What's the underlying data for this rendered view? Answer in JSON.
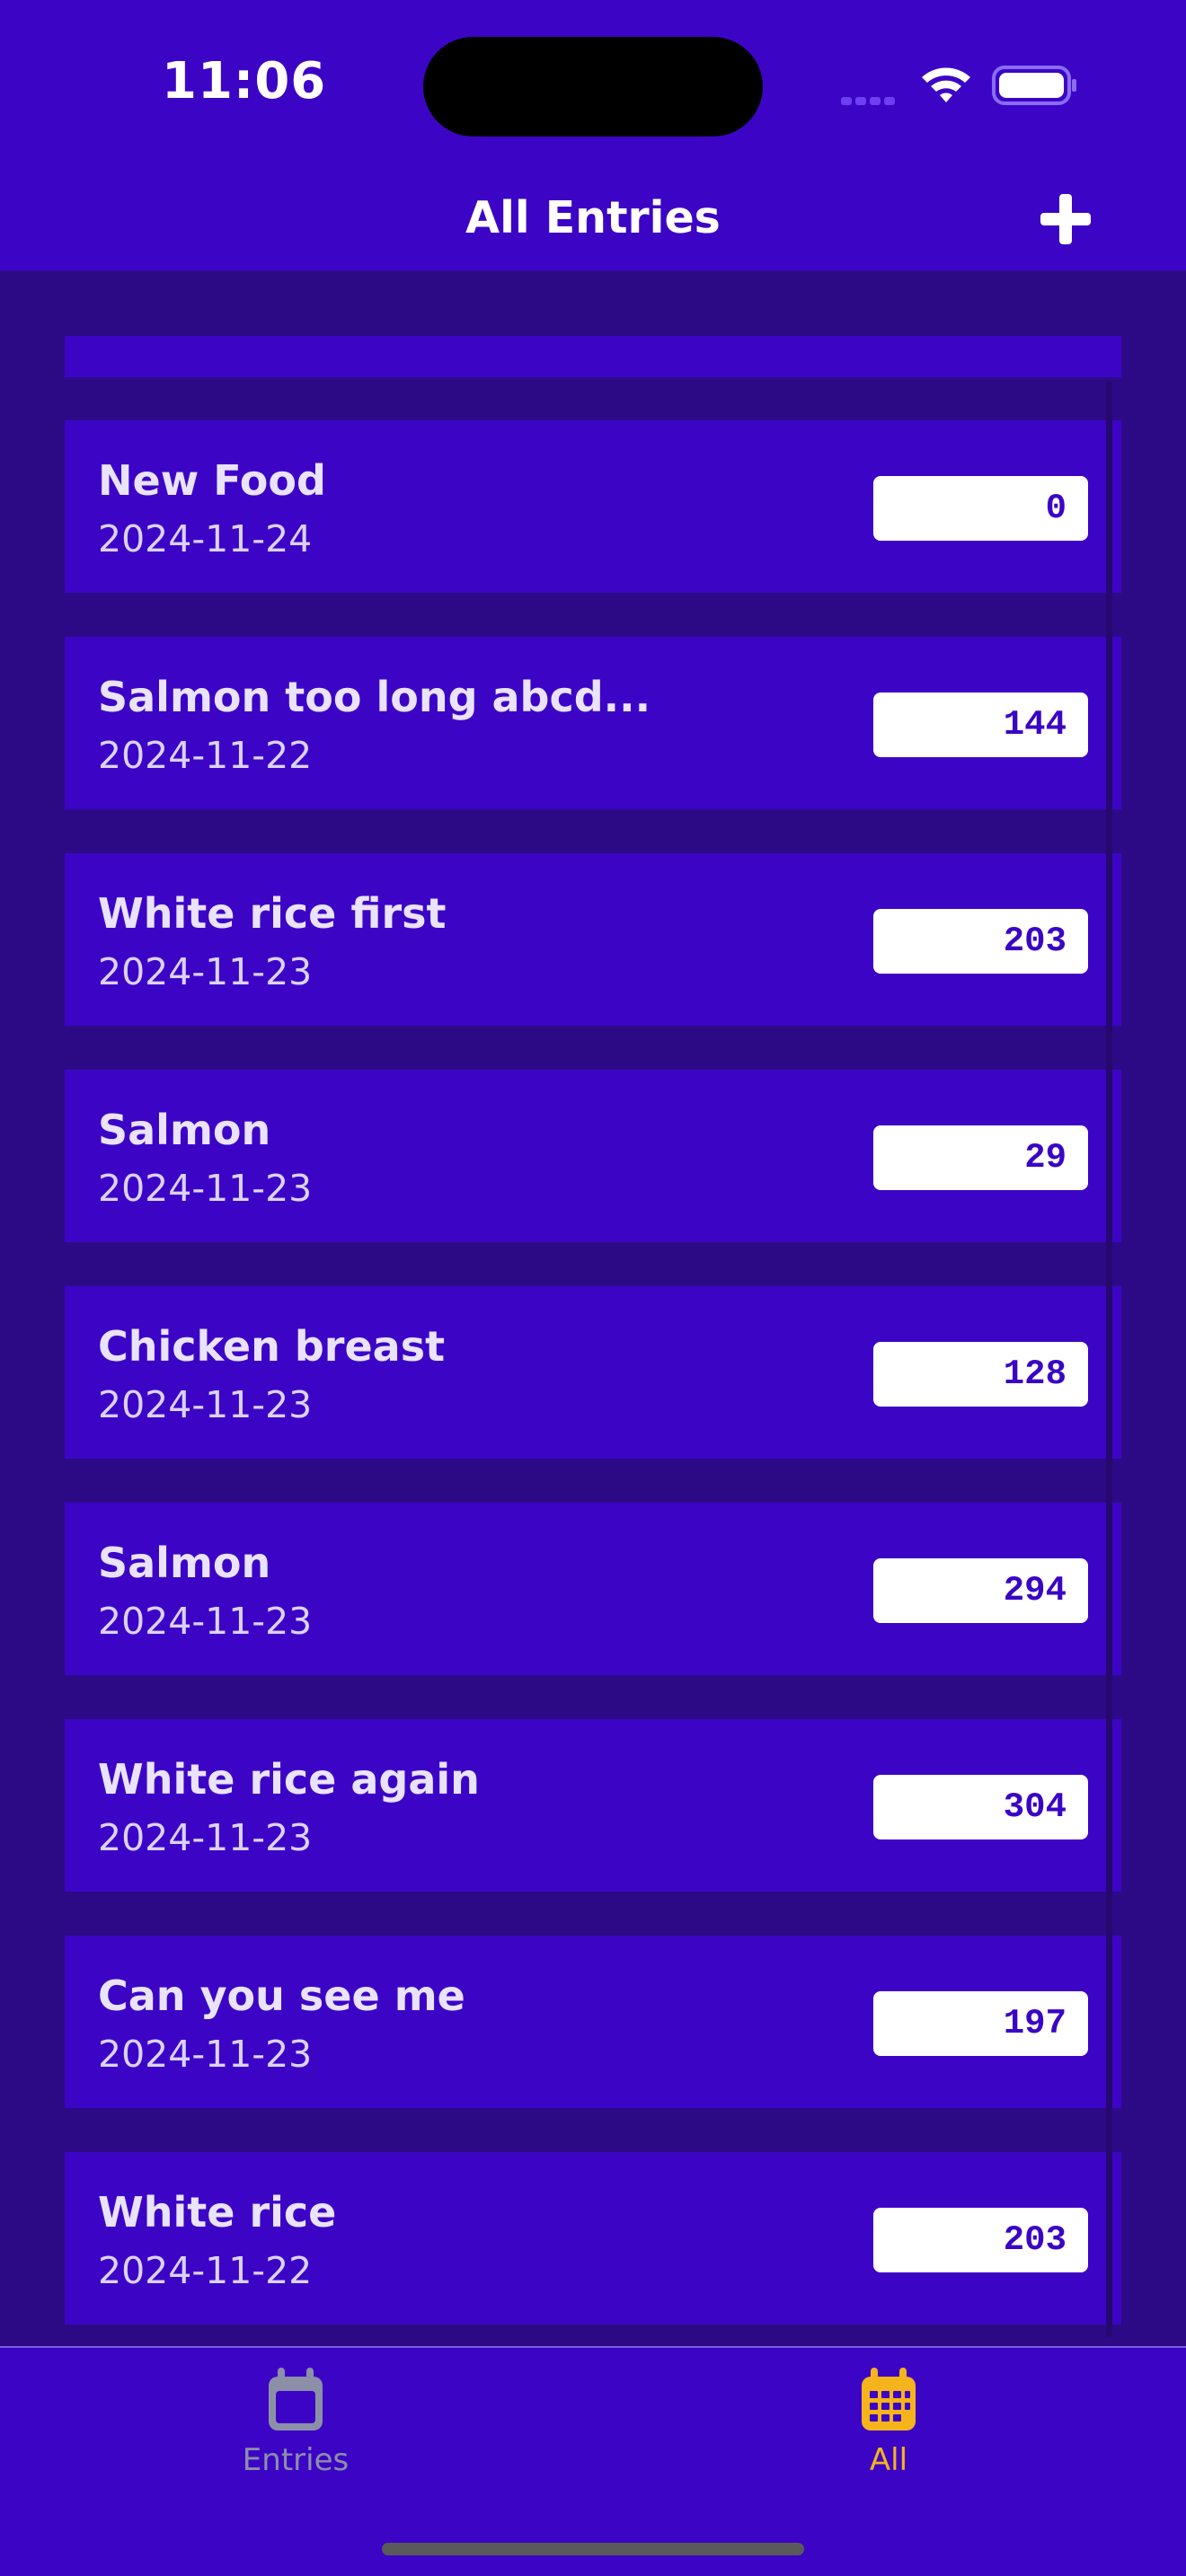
{
  "status": {
    "time": "11:06"
  },
  "nav": {
    "title": "All Entries",
    "add_icon": "plus-icon"
  },
  "entries": [
    {
      "name": "New Food",
      "date": "2024-11-24",
      "value": "0"
    },
    {
      "name": "Salmon too long abcd...",
      "date": "2024-11-22",
      "value": "144"
    },
    {
      "name": "White rice first",
      "date": "2024-11-23",
      "value": "203"
    },
    {
      "name": "Salmon",
      "date": "2024-11-23",
      "value": "29"
    },
    {
      "name": "Chicken breast",
      "date": "2024-11-23",
      "value": "128"
    },
    {
      "name": "Salmon",
      "date": "2024-11-23",
      "value": "294"
    },
    {
      "name": "White rice again",
      "date": "2024-11-23",
      "value": "304"
    },
    {
      "name": "Can you see me",
      "date": "2024-11-23",
      "value": "197"
    },
    {
      "name": "White rice",
      "date": "2024-11-22",
      "value": "203"
    }
  ],
  "tabs": [
    {
      "label": "Entries",
      "icon": "calendar-icon",
      "selected": false
    },
    {
      "label": "All",
      "icon": "calendar-grid-icon",
      "selected": true
    }
  ],
  "colors": {
    "accent": "#f5b41c",
    "background": "#2c0a86",
    "row": "#3c05c6",
    "inactive_tab": "#8c8fa8"
  }
}
